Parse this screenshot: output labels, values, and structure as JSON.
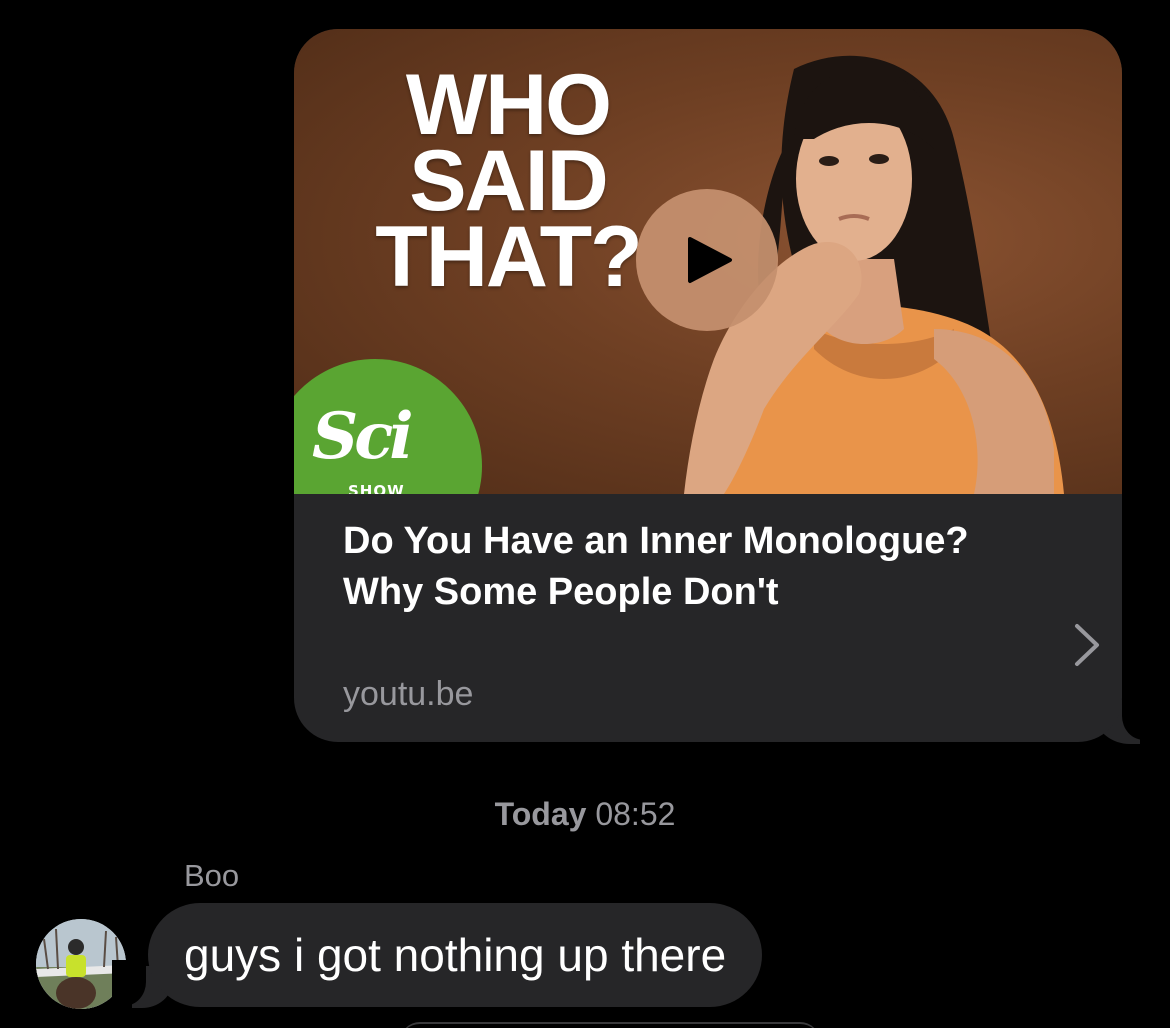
{
  "link_preview": {
    "thumbnail_headline": "WHO\nSAID\nTHAT?",
    "logo_text": "Sci",
    "logo_subtext": "SHOW",
    "title": "Do You Have an Inner Monologue? Why Some People Don't",
    "domain": "youtu.be",
    "play_icon": "play-icon",
    "chevron_icon": "chevron-right-icon",
    "colors": {
      "bubble": "#262628",
      "logo_green": "#5aa532",
      "play_button": "#c48f6e"
    }
  },
  "timestamp": {
    "day": "Today",
    "time": "08:52"
  },
  "message": {
    "sender": "Boo",
    "text": "guys i got nothing up there",
    "avatar_icon": "user-avatar"
  }
}
